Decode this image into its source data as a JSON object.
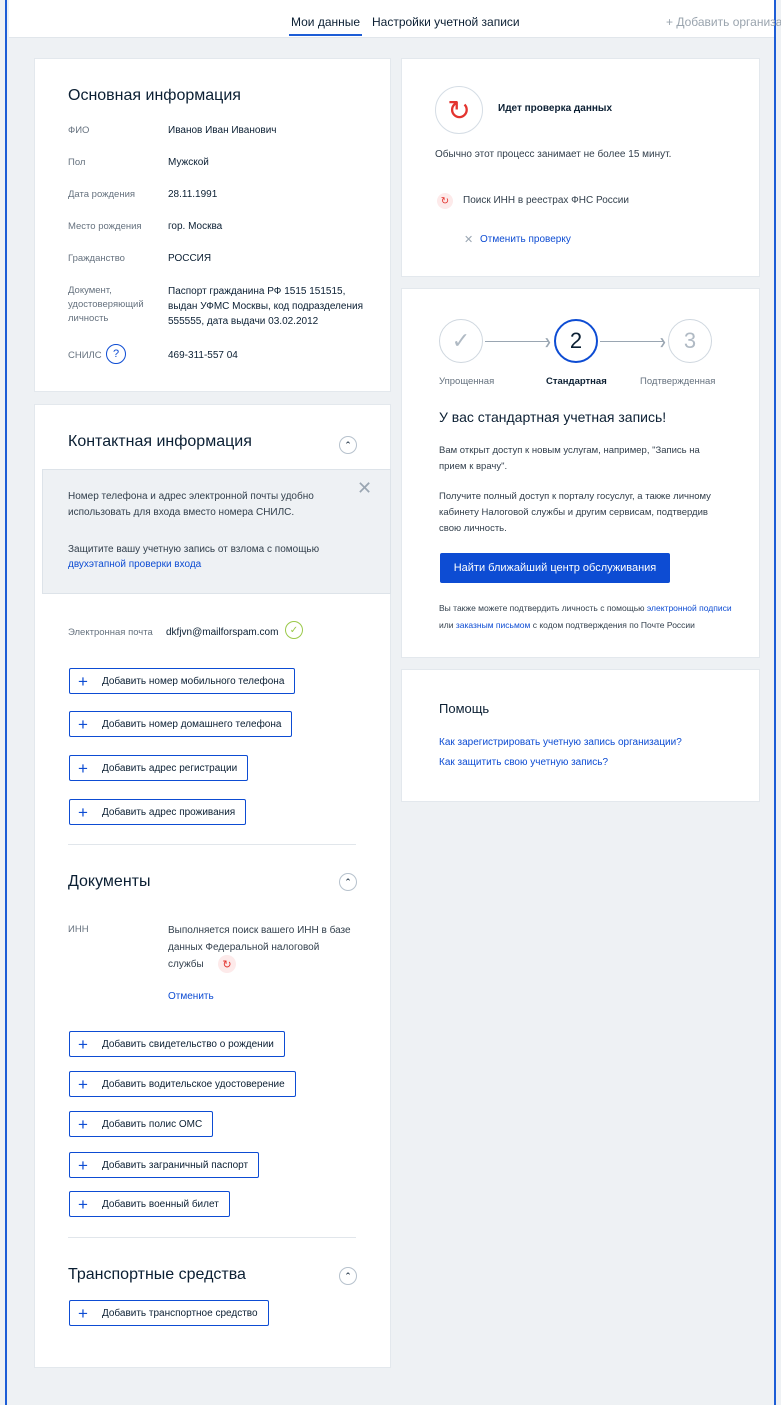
{
  "nav": {
    "tab_my_data": "Мои данные",
    "tab_account_settings": "Настройки учетной записи",
    "add_org": "+ Добавить организаци"
  },
  "basic": {
    "title": "Основная информация",
    "rows": [
      {
        "label": "ФИО",
        "value": "Иванов Иван Иванович"
      },
      {
        "label": "Пол",
        "value": "Мужской"
      },
      {
        "label": "Дата рождения",
        "value": "28.11.1991"
      },
      {
        "label": "Место рождения",
        "value": "гор. Москва"
      },
      {
        "label": "Гражданство",
        "value": "РОССИЯ"
      }
    ],
    "document_label": "Документ, удостоверяющий личность",
    "document_value": "Паспорт гражданина РФ 1515 151515, выдан УФМС Москвы, код подразделения 555555, дата выдачи 03.02.2012",
    "snils_label": "СНИЛС",
    "snils_help": "?",
    "snils_value": "469-311-557 04"
  },
  "contact": {
    "title": "Контактная информация",
    "notice_text": "Номер телефона и адрес электронной почты удобно использовать для входа вместо номера СНИЛС.",
    "notice_text2": "Защитите вашу учетную запись от взлома с помощью",
    "notice_link": "двухэтапной проверки входа",
    "email_label": "Электронная почта",
    "email_value": "dkfjvn@mailforspam.com",
    "buttons": [
      "Добавить номер мобильного телефона",
      "Добавить номер домашнего телефона",
      "Добавить адрес регистрации",
      "Добавить адрес проживания"
    ]
  },
  "documents": {
    "title": "Документы",
    "inn_label": "ИНН",
    "inn_status": "Выполняется поиск вашего ИНН в базе данных Федеральной налоговой службы",
    "cancel": "Отменить",
    "buttons": [
      "Добавить свидетельство о рождении",
      "Добавить водительское удостоверение",
      "Добавить полис ОМС",
      "Добавить заграничный паспорт",
      "Добавить военный билет"
    ]
  },
  "vehicles": {
    "title": "Транспортные средства",
    "button": "Добавить транспортное средство"
  },
  "check": {
    "title": "Идет проверка данных",
    "subtitle": "Обычно этот процесс занимает не более 15 минут.",
    "item": "Поиск ИНН в реестрах ФНС России",
    "cancel": "Отменить проверку"
  },
  "account": {
    "steps": [
      {
        "num": "",
        "label": "Упрощенная"
      },
      {
        "num": "2",
        "label": "Стандартная"
      },
      {
        "num": "3",
        "label": "Подтвержденная"
      }
    ],
    "title": "У вас стандартная учетная запись!",
    "p1": "Вам открыт доступ к новым услугам, например, \"Запись на прием к врачу\".",
    "p2": "Получите полный доступ к порталу госуслуг, а также личному кабинету Налоговой службы и другим сервисам, подтвердив свою личность.",
    "button": "Найти ближайший центр обслуживания",
    "foot1": "Вы также можете подтвердить личность с помощью",
    "foot_link1": "электронной подписи",
    "foot2": "или",
    "foot_link2": "заказным письмом",
    "foot3": "с кодом подтверждения по Почте России"
  },
  "help": {
    "title": "Помощь",
    "links": [
      "Как зарегистрировать учетную запись организации?",
      "Как защитить свою учетную запись?"
    ]
  },
  "colors": {
    "accent": "#0d4cd3",
    "error": "#e3342f",
    "success": "#9bc94a"
  }
}
